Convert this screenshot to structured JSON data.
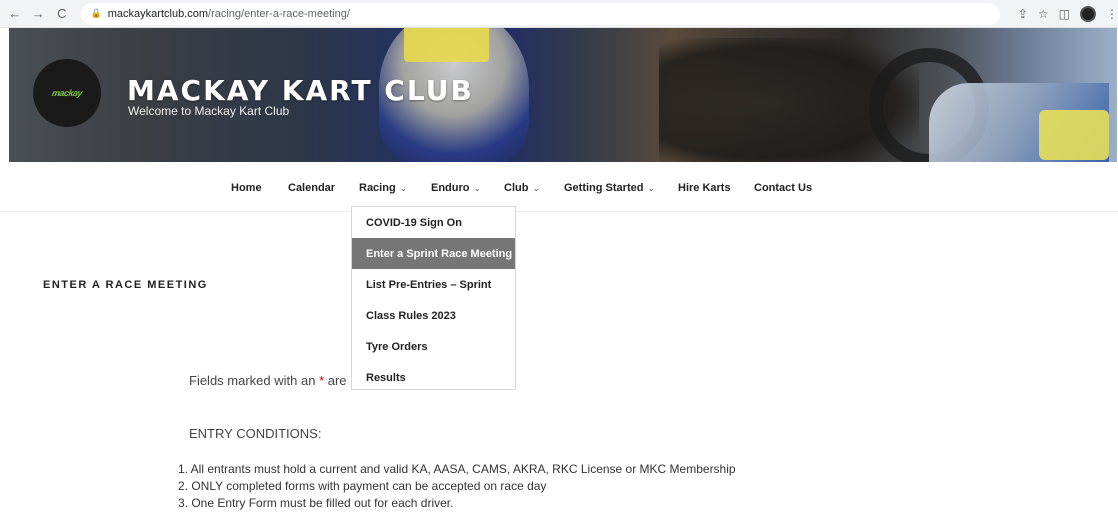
{
  "browser": {
    "url_domain": "mackaykartclub.com",
    "url_path": "/racing/enter-a-race-meeting/",
    "back_glyph": "←",
    "forward_glyph": "→",
    "reload_glyph": "C",
    "lock_glyph": "🔒",
    "share_glyph": "⇪",
    "star_glyph": "☆",
    "panel_glyph": "◫",
    "menu_glyph": "⋮"
  },
  "site": {
    "logo_text": "mackay",
    "title": "MACKAY KART CLUB",
    "tagline": "Welcome to Mackay Kart Club"
  },
  "nav": {
    "caret_glyph": "⌄",
    "items": [
      {
        "label": "Home",
        "has_submenu": false
      },
      {
        "label": "Calendar",
        "has_submenu": false
      },
      {
        "label": "Racing",
        "has_submenu": true
      },
      {
        "label": "Enduro",
        "has_submenu": true
      },
      {
        "label": "Club",
        "has_submenu": true
      },
      {
        "label": "Getting Started",
        "has_submenu": true
      },
      {
        "label": "Hire Karts",
        "has_submenu": false
      },
      {
        "label": "Contact Us",
        "has_submenu": false
      }
    ]
  },
  "racing_dropdown": {
    "items": [
      {
        "label": "COVID-19 Sign On",
        "active": false
      },
      {
        "label": "Enter a Sprint Race Meeting",
        "active": true
      },
      {
        "label": "List Pre-Entries – Sprint",
        "active": false
      },
      {
        "label": "Class Rules 2023",
        "active": false
      },
      {
        "label": "Tyre Orders",
        "active": false
      },
      {
        "label": "Results",
        "active": false
      }
    ]
  },
  "page": {
    "title": "ENTER A RACE MEETING",
    "required_before": "Fields marked with an ",
    "required_star": "*",
    "required_after": " are required",
    "conditions_heading": "ENTRY CONDITIONS:",
    "conditions": [
      "1. All entrants must hold a current and valid KA, AASA, CAMS, AKRA, RKC License or MKC Membership",
      "2. ONLY completed forms with payment can be accepted on race day",
      "3. One Entry Form must be filled out for each driver."
    ]
  },
  "colors": {
    "dropdown_active_bg": "#767676",
    "required_star": "#cc0000",
    "logo_green": "#7ac243"
  }
}
